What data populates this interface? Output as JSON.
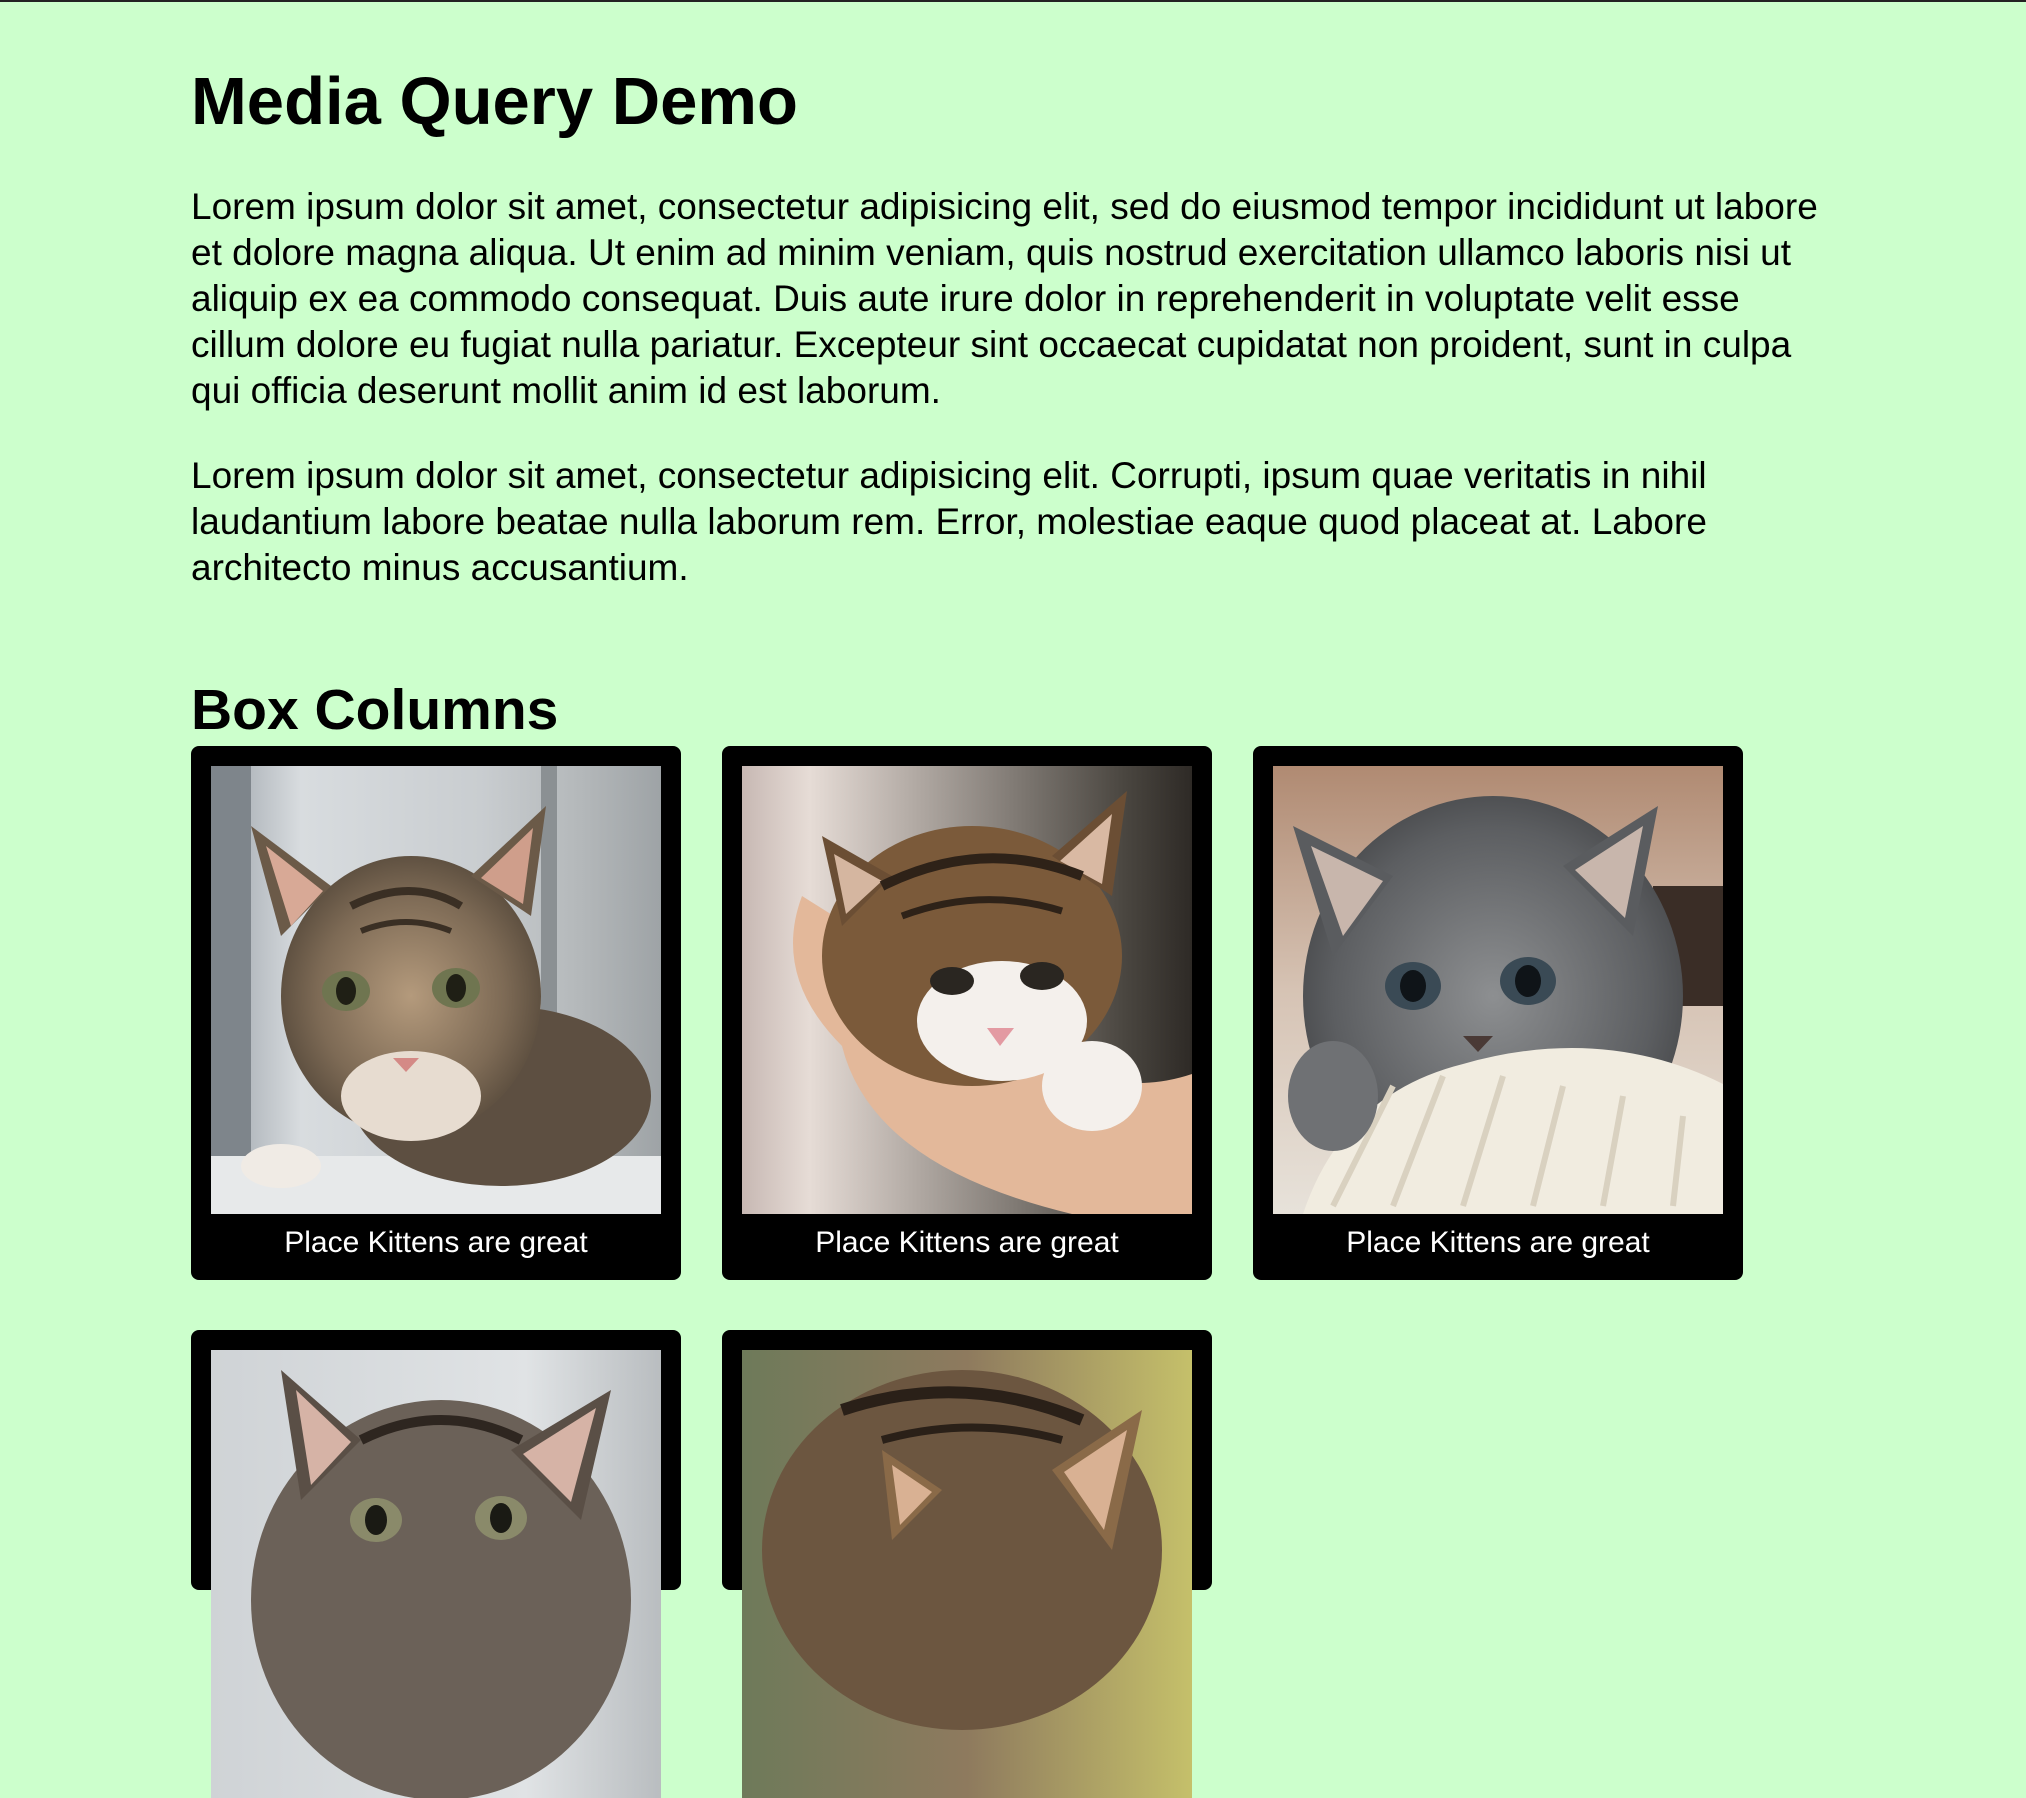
{
  "page": {
    "title": "Media Query Demo",
    "paragraphs": [
      "Lorem ipsum dolor sit amet, consectetur adipisicing elit, sed do eiusmod tempor incididunt ut labore et dolore magna aliqua. Ut enim ad minim veniam, quis nostrud exercitation ullamco laboris nisi ut aliquip ex ea commodo consequat. Duis aute irure dolor in reprehenderit in voluptate velit esse cillum dolore eu fugiat nulla pariatur. Excepteur sint occaecat cupidatat non proident, sunt in culpa qui officia deserunt mollit anim id est laborum.",
      "Lorem ipsum dolor sit amet, consectetur adipisicing elit. Corrupti, ipsum quae veritatis in nihil laudantium labore beatae nulla laborum rem. Error, molestiae eaque quod placeat at. Labore architecto minus accusantium."
    ]
  },
  "box_columns": {
    "heading": "Box Columns",
    "cards": [
      {
        "caption": "Place Kittens are great",
        "image": "tabby-kitten-on-windowsill"
      },
      {
        "caption": "Place Kittens are great",
        "image": "kitten-held-in-hand"
      },
      {
        "caption": "Place Kittens are great",
        "image": "grey-fluffy-kitten"
      },
      {
        "caption": "",
        "image": "fluffy-tabby-kitten"
      },
      {
        "caption": "",
        "image": "kitten-closeup"
      }
    ]
  },
  "colors": {
    "background": "#ccffcc",
    "card": "#000000",
    "caption_text": "#ffffff"
  }
}
